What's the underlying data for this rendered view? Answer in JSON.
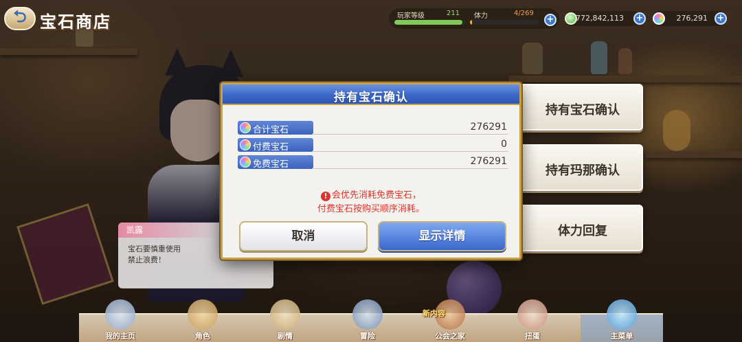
{
  "header": {
    "back_icon": "back-arrow-icon",
    "title": "宝石商店"
  },
  "player_stats": {
    "level_label": "玩家等级",
    "level_value": "211",
    "level_progress": 0.95,
    "stamina_label": "体力",
    "stamina_value": "4/269",
    "stamina_progress": 0.015
  },
  "currencies": {
    "mana_value": "772,842,113",
    "gem_value": "276,291"
  },
  "side_menu": [
    {
      "label": "持有宝石确认",
      "icon": "rainbow-gem-icon"
    },
    {
      "label": "持有玛那确认",
      "icon": "mana-coin-icon"
    },
    {
      "label": "体力回复",
      "icon": "stamina-icon"
    }
  ],
  "speech_bubble": {
    "speaker": "凯露",
    "line1": "宝石要慎重使用",
    "line2": "禁止浪费！"
  },
  "bottom_nav": [
    {
      "label": "我的主页",
      "icon": "home-icon"
    },
    {
      "label": "角色",
      "icon": "character-icon"
    },
    {
      "label": "剧情",
      "icon": "story-scroll-icon"
    },
    {
      "label": "冒险",
      "icon": "adventure-sword-icon"
    },
    {
      "label": "公会之家",
      "icon": "guild-house-icon",
      "badge": "新内容"
    },
    {
      "label": "扭蛋",
      "icon": "gacha-icon"
    },
    {
      "label": "主菜单",
      "icon": "main-menu-icon",
      "active": true
    }
  ],
  "dialog": {
    "title": "持有宝石确认",
    "rows": [
      {
        "label": "合计宝石",
        "value": "276291"
      },
      {
        "label": "付费宝石",
        "value": "0"
      },
      {
        "label": "免费宝石",
        "value": "276291"
      }
    ],
    "warning_line1": "会优先消耗免费宝石，",
    "warning_line2": "付费宝石按购买顺序消耗。",
    "cancel_label": "取消",
    "detail_label": "显示详情"
  },
  "colors": {
    "dialog_header": "#3b68c9",
    "warning_text": "#d8352f",
    "level_bar": "#7ecb5a",
    "stamina_bar": "#f0b34a"
  }
}
